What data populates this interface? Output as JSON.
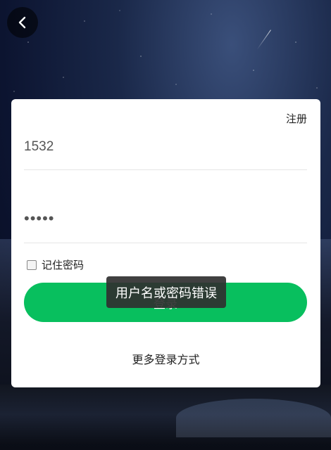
{
  "nav": {
    "back_icon": "chevron-left-icon"
  },
  "header": {
    "register_label": "注册"
  },
  "form": {
    "username_value": "1532",
    "password_mask": "•••••",
    "remember_label": "记住密码",
    "remember_checked": false,
    "login_label": "登录"
  },
  "footer": {
    "more_login_label": "更多登录方式"
  },
  "toast": {
    "message": "用户名或密码错误"
  },
  "colors": {
    "accent": "#08bf5e",
    "toast_bg": "#303030"
  }
}
